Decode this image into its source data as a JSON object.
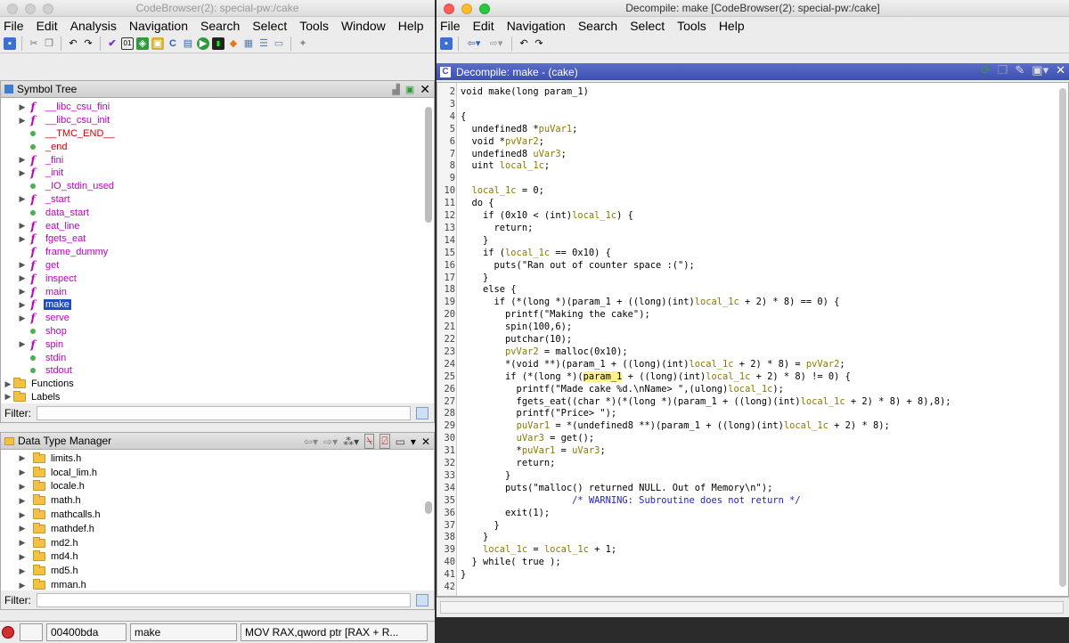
{
  "left_window": {
    "title": "CodeBrowser(2): special-pw:/cake",
    "menu": [
      "File",
      "Edit",
      "Analysis",
      "Navigation",
      "Search",
      "Select",
      "Tools",
      "Window",
      "Help"
    ],
    "symbol_tree": {
      "title": "Symbol Tree",
      "items": [
        {
          "label": "__libc_csu_fini",
          "kind": "function",
          "expandable": true
        },
        {
          "label": "__libc_csu_init",
          "kind": "function",
          "expandable": true
        },
        {
          "label": "__TMC_END__",
          "kind": "label-red",
          "expandable": false
        },
        {
          "label": "_end",
          "kind": "label-red",
          "expandable": false
        },
        {
          "label": "_fini",
          "kind": "function",
          "expandable": true
        },
        {
          "label": "_init",
          "kind": "function",
          "expandable": true
        },
        {
          "label": "_IO_stdin_used",
          "kind": "label",
          "expandable": false
        },
        {
          "label": "_start",
          "kind": "function",
          "expandable": true
        },
        {
          "label": "data_start",
          "kind": "label",
          "expandable": false
        },
        {
          "label": "eat_line",
          "kind": "function",
          "expandable": true
        },
        {
          "label": "fgets_eat",
          "kind": "function",
          "expandable": true
        },
        {
          "label": "frame_dummy",
          "kind": "function",
          "expandable": false
        },
        {
          "label": "get",
          "kind": "function",
          "expandable": true
        },
        {
          "label": "inspect",
          "kind": "function",
          "expandable": true
        },
        {
          "label": "main",
          "kind": "function",
          "expandable": true
        },
        {
          "label": "make",
          "kind": "function",
          "expandable": true,
          "selected": true
        },
        {
          "label": "serve",
          "kind": "function",
          "expandable": true
        },
        {
          "label": "shop",
          "kind": "label",
          "expandable": false
        },
        {
          "label": "spin",
          "kind": "function",
          "expandable": true
        },
        {
          "label": "stdin",
          "kind": "label",
          "expandable": false
        },
        {
          "label": "stdout",
          "kind": "label",
          "expandable": false
        }
      ],
      "folders": [
        "Functions",
        "Labels"
      ]
    },
    "filter_label": "Filter:",
    "data_type_manager": {
      "title": "Data Type Manager",
      "items": [
        "limits.h",
        "local_lim.h",
        "locale.h",
        "math.h",
        "mathcalls.h",
        "mathdef.h",
        "md2.h",
        "md4.h",
        "md5.h",
        "mman.h"
      ]
    },
    "status": {
      "address": "00400bda",
      "function": "make",
      "instruction": "MOV RAX,qword ptr [RAX + R..."
    }
  },
  "right_window": {
    "title": "Decompile: make [CodeBrowser(2): special-pw:/cake]",
    "menu": [
      "File",
      "Edit",
      "Navigation",
      "Search",
      "Select",
      "Tools",
      "Help"
    ],
    "panel_title": "Decompile: make -  (cake)",
    "code_lines": [
      {
        "n": "2",
        "t": "void make(long param_1)"
      },
      {
        "n": "3",
        "t": ""
      },
      {
        "n": "4",
        "t": "{"
      },
      {
        "n": "5",
        "t": "  undefined8 *puVar1;"
      },
      {
        "n": "6",
        "t": "  void *pvVar2;"
      },
      {
        "n": "7",
        "t": "  undefined8 uVar3;"
      },
      {
        "n": "8",
        "t": "  uint local_1c;"
      },
      {
        "n": "9",
        "t": ""
      },
      {
        "n": "10",
        "t": "  local_1c = 0;"
      },
      {
        "n": "11",
        "t": "  do {"
      },
      {
        "n": "12",
        "t": "    if (0x10 < (int)local_1c) {"
      },
      {
        "n": "13",
        "t": "      return;"
      },
      {
        "n": "14",
        "t": "    }"
      },
      {
        "n": "15",
        "t": "    if (local_1c == 0x10) {"
      },
      {
        "n": "16",
        "t": "      puts(\"Ran out of counter space :(\");"
      },
      {
        "n": "17",
        "t": "    }"
      },
      {
        "n": "18",
        "t": "    else {"
      },
      {
        "n": "19",
        "t": "      if (*(long *)(param_1 + ((long)(int)local_1c + 2) * 8) == 0) {"
      },
      {
        "n": "20",
        "t": "        printf(\"Making the cake\");"
      },
      {
        "n": "21",
        "t": "        spin(100,6);"
      },
      {
        "n": "22",
        "t": "        putchar(10);"
      },
      {
        "n": "23",
        "t": "        pvVar2 = malloc(0x10);"
      },
      {
        "n": "24",
        "t": "        *(void **)(param_1 + ((long)(int)local_1c + 2) * 8) = pvVar2;"
      },
      {
        "n": "25",
        "t": "        if (*(long *)(param_1 + ((long)(int)local_1c + 2) * 8) != 0) {"
      },
      {
        "n": "26",
        "t": "          printf(\"Made cake %d.\\nName> \",(ulong)local_1c);"
      },
      {
        "n": "27",
        "t": "          fgets_eat((char *)(*(long *)(param_1 + ((long)(int)local_1c + 2) * 8) + 8),8);"
      },
      {
        "n": "28",
        "t": "          printf(\"Price> \");"
      },
      {
        "n": "29",
        "t": "          puVar1 = *(undefined8 **)(param_1 + ((long)(int)local_1c + 2) * 8);"
      },
      {
        "n": "30",
        "t": "          uVar3 = get();"
      },
      {
        "n": "31",
        "t": "          *puVar1 = uVar3;"
      },
      {
        "n": "32",
        "t": "          return;"
      },
      {
        "n": "33",
        "t": "        }"
      },
      {
        "n": "34",
        "t": "        puts(\"malloc() returned NULL. Out of Memory\\n\");"
      },
      {
        "n": "35",
        "t": "                    /* WARNING: Subroutine does not return */",
        "comment": true
      },
      {
        "n": "36",
        "t": "        exit(1);"
      },
      {
        "n": "37",
        "t": "      }"
      },
      {
        "n": "38",
        "t": "    }"
      },
      {
        "n": "39",
        "t": "    local_1c = local_1c + 1;"
      },
      {
        "n": "40",
        "t": "  } while( true );"
      },
      {
        "n": "41",
        "t": "}"
      },
      {
        "n": "42",
        "t": ""
      }
    ]
  }
}
